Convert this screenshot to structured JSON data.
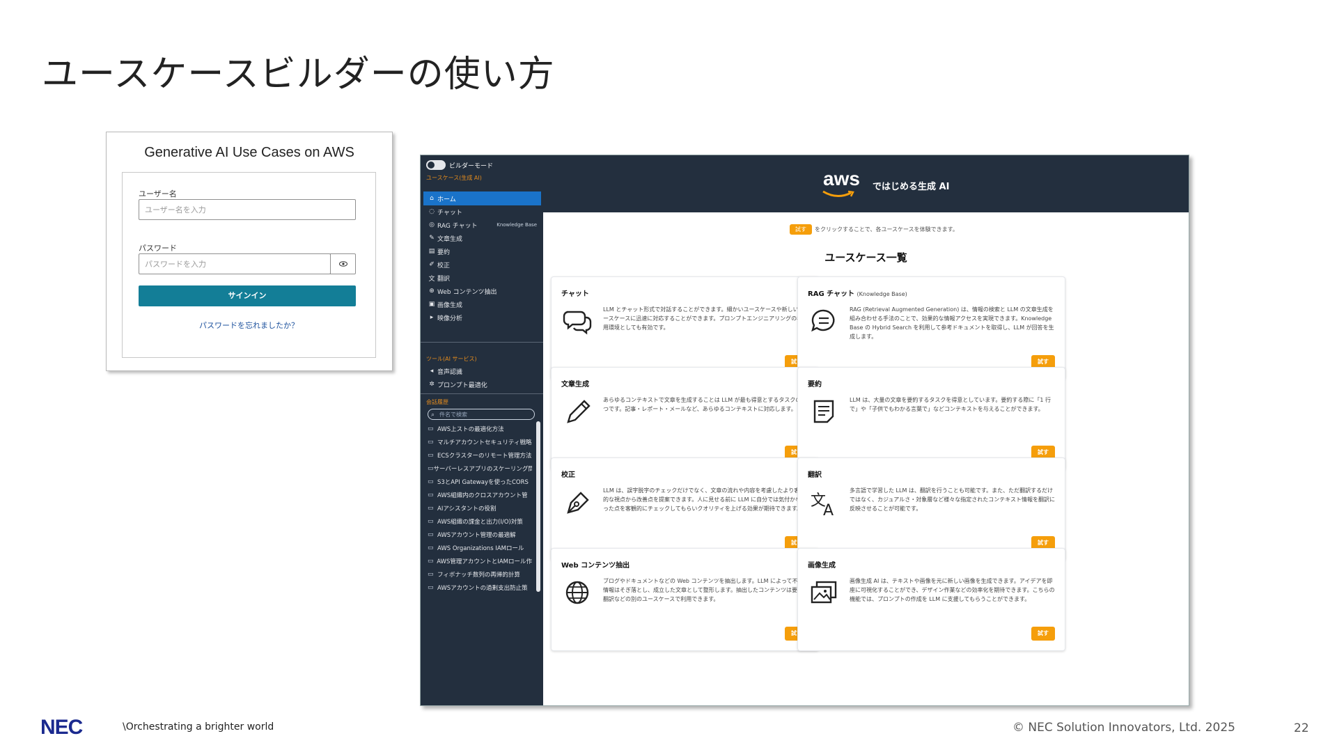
{
  "slide": {
    "title": "ユースケースビルダーの使い方",
    "footer_tagline": "\\Orchestrating a brighter world",
    "footer_logo": "NEC",
    "copyright": "© NEC Solution Innovators, Ltd. 2025",
    "page_number": "22"
  },
  "login": {
    "title": "Generative AI Use Cases on AWS",
    "username_label": "ユーザー名",
    "username_placeholder": "ユーザー名を入力",
    "password_label": "パスワード",
    "password_placeholder": "パスワードを入力",
    "signin_label": "サインイン",
    "forgot_label": "パスワードを忘れましたか？"
  },
  "app": {
    "builder_mode_label": "ビルダーモード",
    "section_use_cases": "ユースケース(生成 AI)",
    "nav": [
      {
        "icon": "⌂",
        "label": "ホーム",
        "active": true
      },
      {
        "icon": "◌",
        "label": "チャット"
      },
      {
        "icon": "◎",
        "label": "RAG チャット",
        "sub": "Knowledge Base"
      },
      {
        "icon": "✎",
        "label": "文章生成"
      },
      {
        "icon": "▤",
        "label": "要約"
      },
      {
        "icon": "✐",
        "label": "校正"
      },
      {
        "icon": "文",
        "label": "翻訳"
      },
      {
        "icon": "⊕",
        "label": "Web コンテンツ抽出"
      },
      {
        "icon": "▣",
        "label": "画像生成"
      },
      {
        "icon": "▸",
        "label": "映像分析"
      }
    ],
    "section_tools": "ツール(AI サービス)",
    "tools": [
      {
        "icon": "◂",
        "label": "音声認識"
      },
      {
        "icon": "✲",
        "label": "プロンプト最適化"
      }
    ],
    "section_history": "会話履歴",
    "history_search_placeholder": "件名で検索",
    "history": [
      "AWS上ストの最適化方法",
      "マルチアカウントセキュリティ戦略",
      "ECSクラスターのリモート管理方法",
      "サーバーレスアプリのスケーリング問",
      "S3とAPI Gatewayを使ったCORS",
      "AWS組織内のクロスアカウント管",
      "AIアシスタントの役割",
      "AWS組織の課金と出力(I/O)対策",
      "AWSアカウント管理の最適解",
      "AWS Organizations IAMロール",
      "AWS管理アカウントとIAMロール作",
      "フィボナッチ数列の再帰的計算",
      "AWSアカウントの過剰支出防止策"
    ],
    "header_logo": "aws",
    "header_title": "ではじめる生成 AI",
    "hint_button": "試す",
    "hint_text": "をクリックすることで、各ユースケースを体験できます。",
    "heading": "ユースケース一覧",
    "try_label": "試す",
    "cards": [
      {
        "title": "チャット",
        "sub": "",
        "icon": "chat-icon",
        "desc": "LLM とチャット形式で対話することができます。細かいユースケースや新しいユースケースに迅速に対応することができます。プロンプトエンジニアリングの検証用環境としても有効です。"
      },
      {
        "title": "RAG チャット",
        "sub": "(Knowledge Base)",
        "icon": "message-icon",
        "desc": "RAG (Retrieval Augmented Generation) は、情報の検索と LLM の文章生成を組み合わせる手法のことで、効果的な情報アクセスを実現できます。Knowledge Base の Hybrid Search を利用して参考ドキュメントを取得し、LLM が回答を生成します。"
      },
      {
        "title": "文章生成",
        "sub": "",
        "icon": "pencil-icon",
        "desc": "あらゆるコンテキストで文章を生成することは LLM が最も得意とするタスクの 1 つです。記事・レポート・メールなど、あらゆるコンテキストに対応します。"
      },
      {
        "title": "要約",
        "sub": "",
        "icon": "document-icon",
        "desc": "LLM は、大量の文章を要約するタスクを得意としています。要約する際に「1 行で」や「子供でもわかる言葉で」などコンテキストを与えることができます。"
      },
      {
        "title": "校正",
        "sub": "",
        "icon": "pen-nib-icon",
        "desc": "LLM は、誤字脱字のチェックだけでなく、文章の流れや内容を考慮したより客観的な視点から改善点を提案できます。人に見せる前に LLM に自分では気付かなかった点を客観的にチェックしてもらいクオリティを上げる効果が期待できます。"
      },
      {
        "title": "翻訳",
        "sub": "",
        "icon": "translate-icon",
        "desc": "多言語で学習した LLM は、翻訳を行うことも可能です。また、ただ翻訳するだけではなく、カジュアルさ・対象層など様々な指定されたコンテキスト情報を翻訳に反映させることが可能です。"
      },
      {
        "title": "Web コンテンツ抽出",
        "sub": "",
        "icon": "globe-icon",
        "desc": "ブログやドキュメントなどの Web コンテンツを抽出します。LLM によって不要な情報はそぎ落とし、成立した文章として整形します。抽出したコンテンツは要約、翻訳などの別のユースケースで利用できます。"
      },
      {
        "title": "画像生成",
        "sub": "",
        "icon": "image-icon",
        "desc": "画像生成 AI は、テキストや画像を元に新しい画像を生成できます。アイデアを即座に可視化することができ、デザイン作業などの効率化を期待できます。こちらの機能では、プロンプトの作成を LLM に支援してもらうことができます。"
      }
    ]
  },
  "colors": {
    "sidebar": "#232f3e",
    "accent": "#f59e0b",
    "signin": "#137e97",
    "active_nav": "#1a73c9",
    "nec_blue": "#1b2a8f"
  }
}
